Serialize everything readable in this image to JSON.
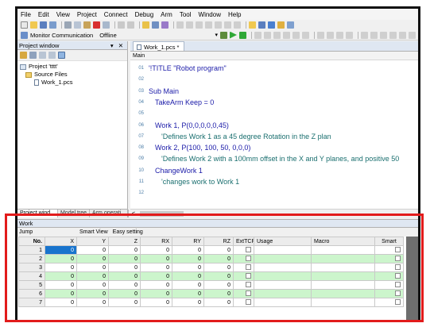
{
  "menu": [
    "File",
    "Edit",
    "View",
    "Project",
    "Connect",
    "Debug",
    "Arm",
    "Tool",
    "Window",
    "Help"
  ],
  "toolbar2": {
    "monitor_label": "Monitor Communication",
    "offline_label": "Offline"
  },
  "project_window": {
    "title": "Project window",
    "controls": "▾ ✕",
    "tree": {
      "project": "Project 'tttt'",
      "source_folder": "Source Files",
      "file": "Work_1.pcs"
    },
    "tabs": [
      "Project wind...",
      "Model tree",
      "Arm operati..."
    ]
  },
  "editor": {
    "tab_label": "Work_1.pcs *",
    "scope_label": "Main",
    "lines": [
      {
        "n": "01",
        "text": "'!TITLE \"Robot program\"",
        "kind": "kw",
        "indent": 0
      },
      {
        "n": "02",
        "text": "",
        "kind": "kw",
        "indent": 0
      },
      {
        "n": "03",
        "text": "Sub Main",
        "kind": "kw",
        "indent": 0
      },
      {
        "n": "04",
        "text": "TakeArm Keep = 0",
        "kind": "kw",
        "indent": 1
      },
      {
        "n": "05",
        "text": "",
        "kind": "kw",
        "indent": 0
      },
      {
        "n": "06",
        "text": "Work 1, P(0,0,0,0,0,45)",
        "kind": "kw",
        "indent": 1
      },
      {
        "n": "07",
        "text": "'Defines Work 1 as a 45 degree Rotation in the Z plan",
        "kind": "comment",
        "indent": 2
      },
      {
        "n": "08",
        "text": "Work 2, P(100, 100, 50, 0,0,0)",
        "kind": "kw",
        "indent": 1
      },
      {
        "n": "09",
        "text": "'Defines Work 2 with a 100mm offset in the X and Y planes, and positive 50",
        "kind": "comment",
        "indent": 2
      },
      {
        "n": "10",
        "text": "ChangeWork 1",
        "kind": "kw",
        "indent": 1
      },
      {
        "n": "11",
        "text": "'changes work to Work 1",
        "kind": "comment",
        "indent": 2
      },
      {
        "n": "12",
        "text": "",
        "kind": "kw",
        "indent": 0
      }
    ],
    "scroll_left": "<"
  },
  "work_panel": {
    "title": "Work",
    "jump_label": "Jump",
    "smart_view_label": "Smart View",
    "easy_setting_label": "Easy setting",
    "columns": [
      "No.",
      "X",
      "Y",
      "Z",
      "RX",
      "RY",
      "RZ",
      "ExtTCP",
      "Usage",
      "Macro",
      "Smart"
    ],
    "rows": [
      {
        "no": "1",
        "x": "0",
        "y": "0",
        "z": "0",
        "rx": "0",
        "ry": "0",
        "rz": "0"
      },
      {
        "no": "2",
        "x": "0",
        "y": "0",
        "z": "0",
        "rx": "0",
        "ry": "0",
        "rz": "0"
      },
      {
        "no": "3",
        "x": "0",
        "y": "0",
        "z": "0",
        "rx": "0",
        "ry": "0",
        "rz": "0"
      },
      {
        "no": "4",
        "x": "0",
        "y": "0",
        "z": "0",
        "rx": "0",
        "ry": "0",
        "rz": "0"
      },
      {
        "no": "5",
        "x": "0",
        "y": "0",
        "z": "0",
        "rx": "0",
        "ry": "0",
        "rz": "0"
      },
      {
        "no": "6",
        "x": "0",
        "y": "0",
        "z": "0",
        "rx": "0",
        "ry": "0",
        "rz": "0"
      },
      {
        "no": "7",
        "x": "0",
        "y": "0",
        "z": "0",
        "rx": "0",
        "ry": "0",
        "rz": "0"
      }
    ]
  },
  "colors": {
    "highlight": "#e21b1b",
    "row_green": "#ccf5cc",
    "selection": "#1874cd",
    "code_blue": "#1a1aa8",
    "comment_teal": "#1a6f6f"
  }
}
